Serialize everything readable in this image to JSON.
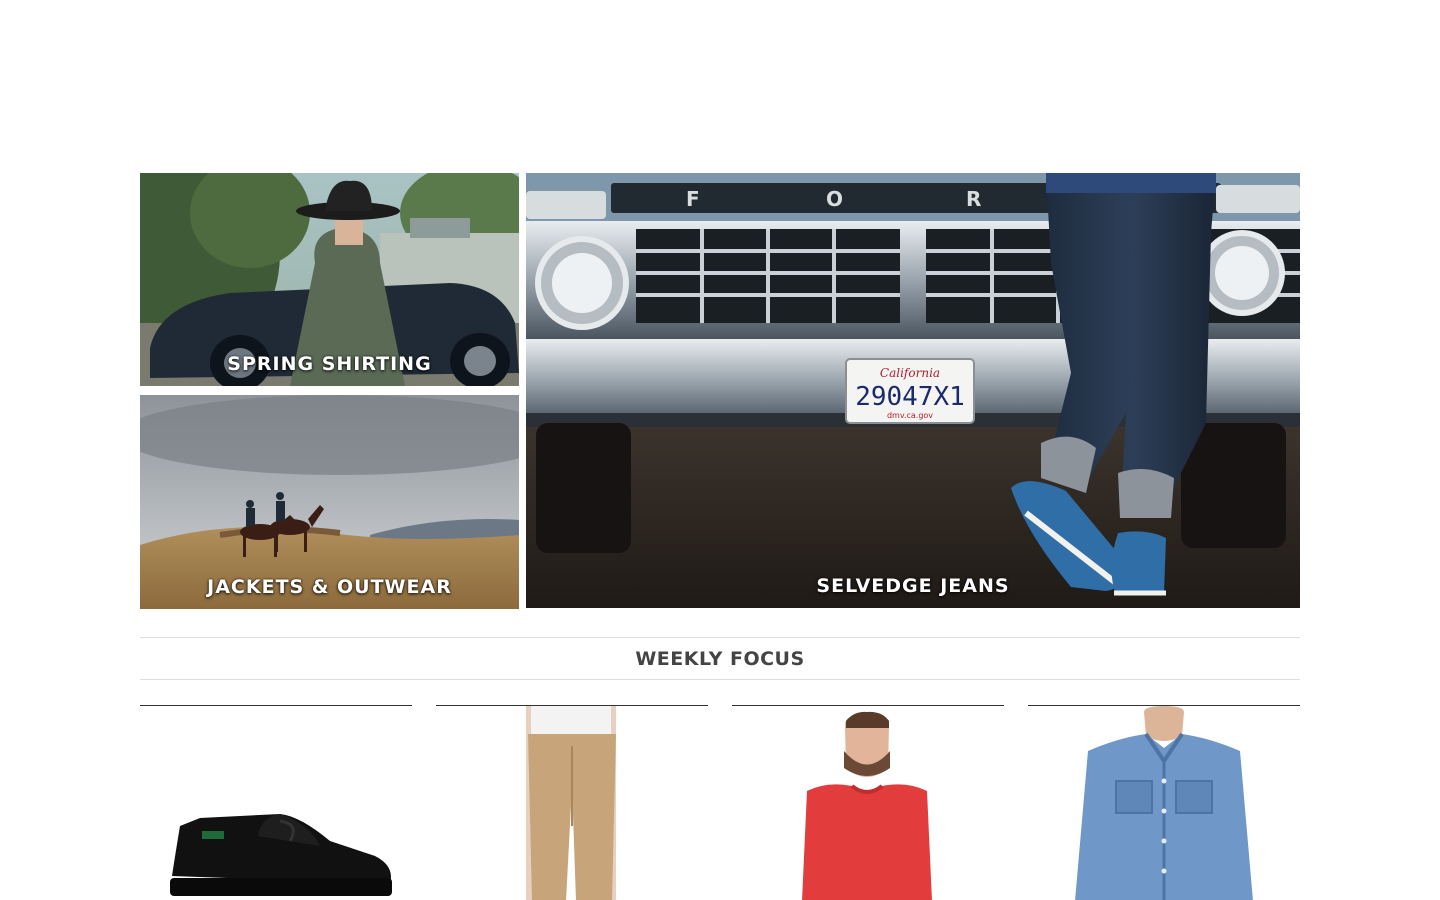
{
  "hero_tiles": {
    "shirting": {
      "label": "SPRING SHIRTING"
    },
    "jackets": {
      "label": "JACKETS & OUTWEAR"
    },
    "jeans": {
      "label": "SELVEDGE JEANS",
      "grille_letters": [
        "F",
        "O",
        "R"
      ],
      "plate_state": "California",
      "plate_number": "29047X1",
      "plate_site": "dmv.ca.gov"
    }
  },
  "weekly_focus": {
    "heading": "WEEKLY FOCUS",
    "products": [
      {
        "image": "black-leather-shoe"
      },
      {
        "image": "khaki-chino-pants"
      },
      {
        "image": "red-sweatshirt"
      },
      {
        "image": "denim-work-shirt"
      }
    ]
  }
}
